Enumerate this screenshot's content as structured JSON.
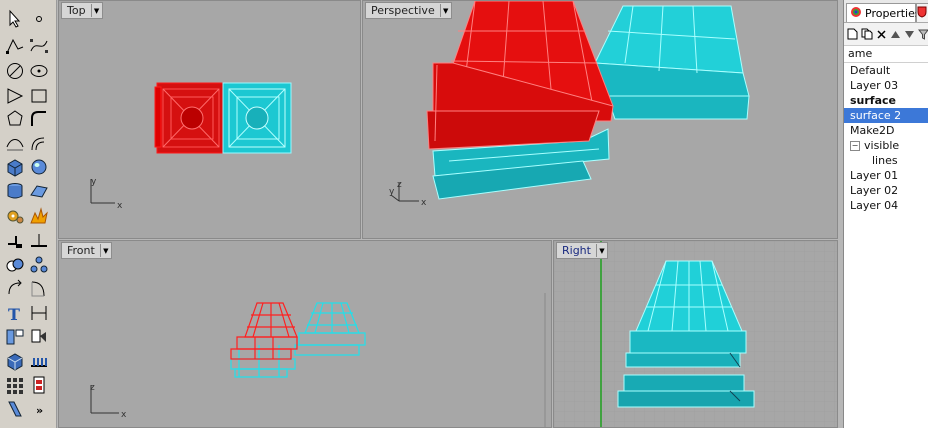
{
  "viewports": {
    "top": {
      "title": "Top",
      "axes": {
        "x": "x",
        "y": "y"
      }
    },
    "perspective": {
      "title": "Perspective",
      "axes": {
        "x": "x",
        "y": "y",
        "z": "z"
      }
    },
    "front": {
      "title": "Front",
      "axes": {
        "x": "x",
        "z": "z"
      }
    },
    "right": {
      "title": "Right"
    }
  },
  "panel": {
    "tab_properties": "Properties",
    "column_header": "ame",
    "layers": [
      {
        "name": "Default",
        "state": "normal"
      },
      {
        "name": "Layer 03",
        "state": "normal"
      },
      {
        "name": "surface",
        "state": "current"
      },
      {
        "name": "surface 2",
        "state": "selected"
      },
      {
        "name": "Make2D",
        "state": "normal"
      },
      {
        "name": "visible",
        "state": "expanded"
      },
      {
        "name": "lines",
        "state": "child"
      },
      {
        "name": "Layer 01",
        "state": "normal"
      },
      {
        "name": "Layer 02",
        "state": "normal"
      },
      {
        "name": "Layer 04",
        "state": "normal"
      }
    ],
    "toggle_symbol": "⊟"
  },
  "toolbar": {
    "more_symbol": "»"
  },
  "colors": {
    "red_object": "#ff1a1a",
    "cyan_object": "#22d8e0",
    "viewport_bg": "#a7a7a7",
    "selected_layer": "#3c78d8",
    "green_axis": "#1fa01f"
  }
}
